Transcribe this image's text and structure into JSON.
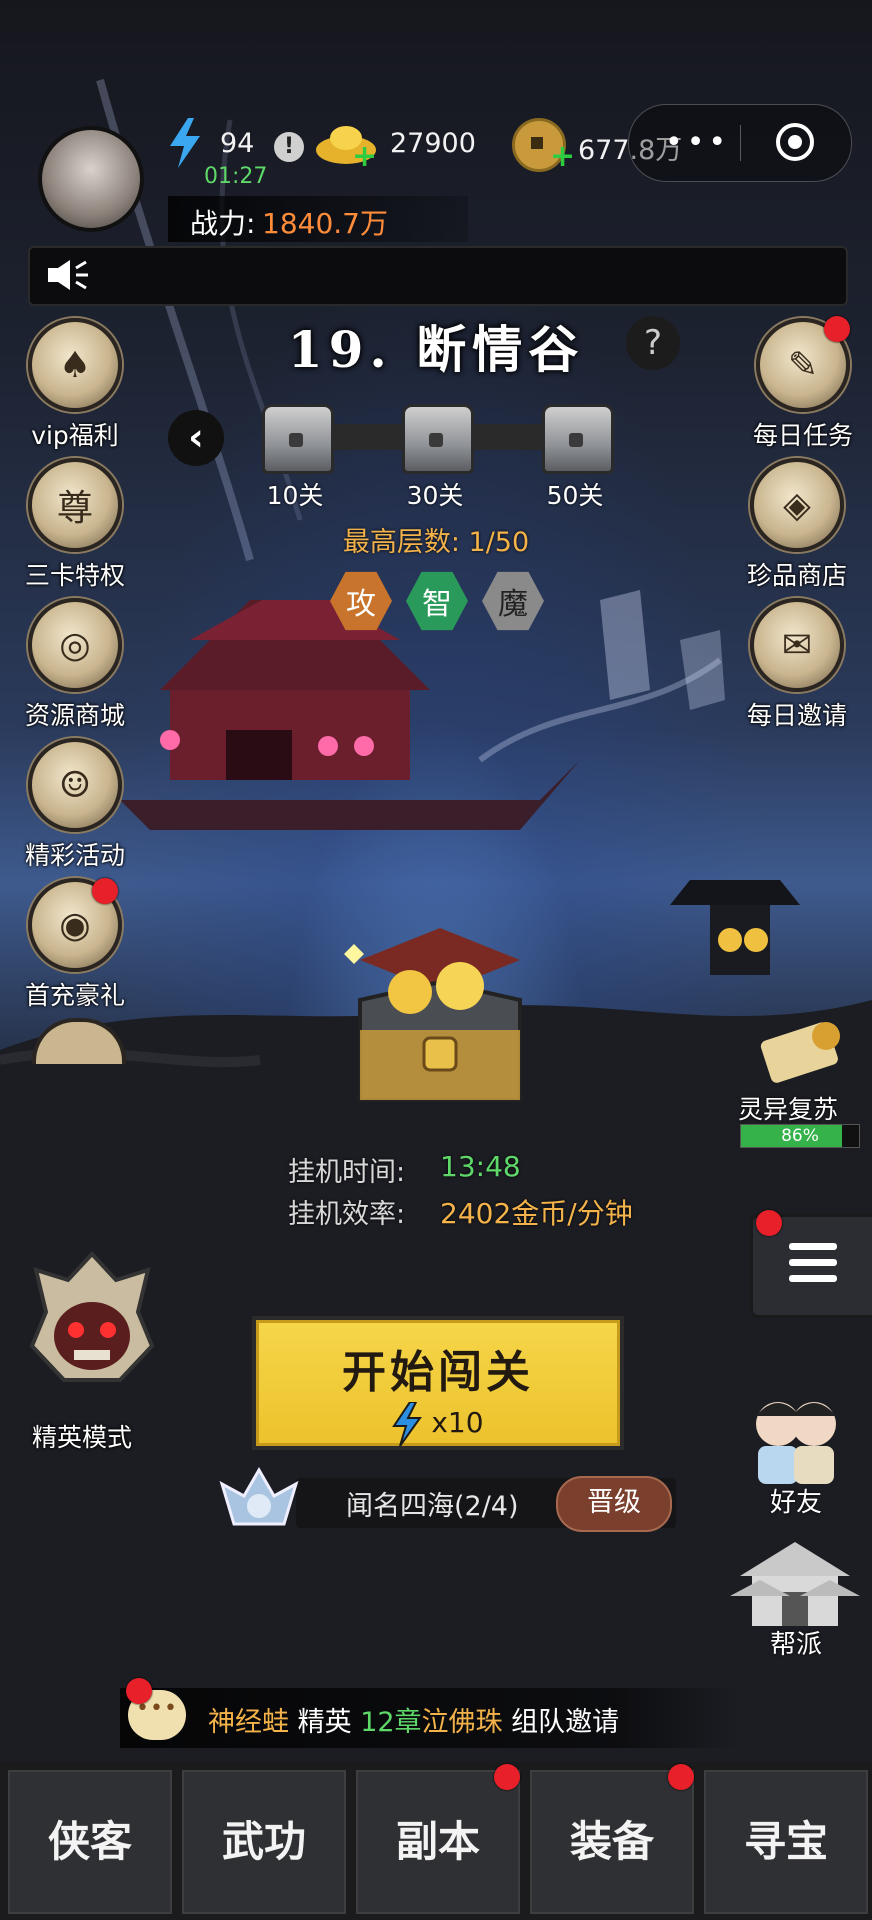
{
  "header": {
    "stamina_value": "94",
    "stamina_timer": "01:27",
    "ingot_value": "27900",
    "coin_value": "677.8万",
    "power_label": "战力:",
    "power_value": "1840.7万"
  },
  "stage": {
    "title": "19. 断情谷",
    "help_symbol": "?",
    "back_symbol": "‹",
    "chests": [
      "10关",
      "30关",
      "50关"
    ],
    "max_floor": "最高层数: 1/50",
    "hex_badges": [
      "攻",
      "智",
      "魔"
    ]
  },
  "left_menu": [
    {
      "label": "vip福利",
      "glyph": "♠",
      "badge": false
    },
    {
      "label": "三卡特权",
      "glyph": "尊",
      "badge": false
    },
    {
      "label": "资源商城",
      "glyph": "◎",
      "badge": false
    },
    {
      "label": "精彩活动",
      "glyph": "☺",
      "badge": false
    },
    {
      "label": "首充豪礼",
      "glyph": "◉",
      "badge": true
    }
  ],
  "right_menu": [
    {
      "label": "每日任务",
      "glyph": "✎",
      "badge": true
    },
    {
      "label": "珍品商店",
      "glyph": "◈",
      "badge": false
    },
    {
      "label": "每日邀请",
      "glyph": "✉",
      "badge": false
    }
  ],
  "revival": {
    "label": "灵异复苏",
    "progress_text": "86%",
    "progress": 0.86
  },
  "idle": {
    "time_label": "挂机时间:",
    "time_value": "13:48",
    "rate_label": "挂机效率:",
    "rate_value": "2402金币/分钟"
  },
  "elite_mode_label": "精英模式",
  "start": {
    "label": "开始闯关",
    "cost": "x10"
  },
  "rank": {
    "text": "闻名四海(2/4)",
    "promote_label": "晋级"
  },
  "social": {
    "friends_label": "好友",
    "guild_label": "帮派"
  },
  "chat": {
    "name": "神经蛙",
    "mode": "精英",
    "chapter": "12章",
    "boss": "泣佛珠",
    "action": "组队邀请"
  },
  "tabs": [
    {
      "label": "侠客",
      "badge": false
    },
    {
      "label": "武功",
      "badge": false
    },
    {
      "label": "副本",
      "badge": true
    },
    {
      "label": "装备",
      "badge": true
    },
    {
      "label": "寻宝",
      "badge": false
    }
  ],
  "colors": {
    "accent_gold": "#f3b24a",
    "power_orange": "#ff8c3a",
    "timer_green": "#5fd86a",
    "badge_red": "#e8202a",
    "button_yellow": "#f1cc3a"
  }
}
